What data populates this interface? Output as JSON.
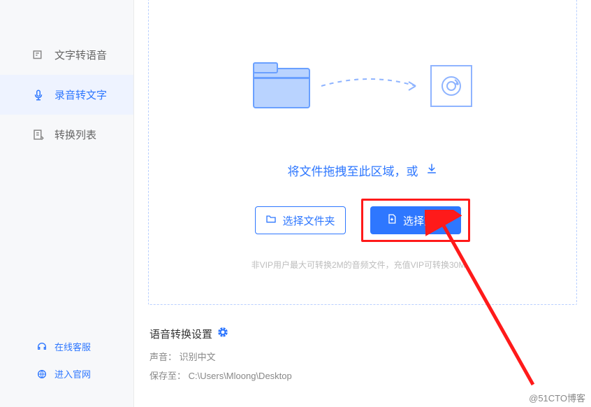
{
  "sidebar": {
    "items": [
      {
        "icon": "tts-icon",
        "label": "文字转语音"
      },
      {
        "icon": "stt-icon",
        "label": "录音转文字"
      },
      {
        "icon": "list-icon",
        "label": "转换列表"
      }
    ],
    "services": [
      {
        "icon": "headset-icon",
        "label": "在线客服"
      },
      {
        "icon": "globe-icon",
        "label": "进入官网"
      }
    ]
  },
  "main": {
    "hint_text": "将文件拖拽至此区域，或",
    "select_folder": "选择文件夹",
    "select_file": "选择文件",
    "tip_text": "非VIP用户最大可转换2M的音频文件，充值VIP可转换30M。"
  },
  "settings": {
    "title": "语音转换设置",
    "sound_label": "声音：",
    "sound_value": "识别中文",
    "save_label": "保存至：",
    "save_value": "C:\\Users\\Mloong\\Desktop"
  },
  "watermark": "@51CTO博客"
}
